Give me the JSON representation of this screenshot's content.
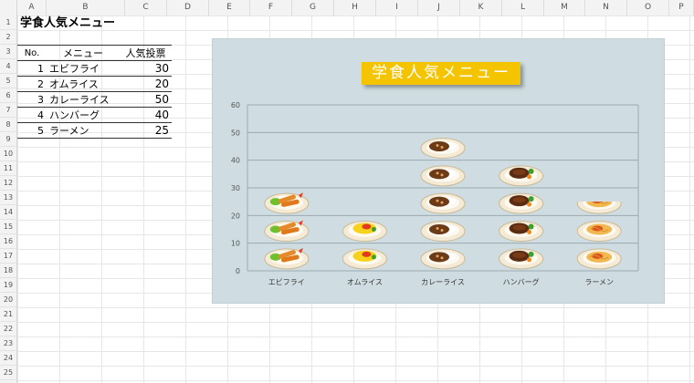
{
  "columns": [
    "A",
    "B",
    "C",
    "D",
    "E",
    "F",
    "G",
    "H",
    "I",
    "J",
    "K",
    "L",
    "M",
    "N",
    "O",
    "P"
  ],
  "rows": [
    "1",
    "2",
    "3",
    "4",
    "5",
    "6",
    "7",
    "8",
    "9",
    "10",
    "11",
    "12",
    "13",
    "14",
    "15",
    "16",
    "17",
    "18",
    "19",
    "20",
    "21",
    "22",
    "23",
    "24",
    "25"
  ],
  "sheet_title": "学食人気メニュー",
  "table": {
    "headers": {
      "no": "No.",
      "menu": "メニュー",
      "votes": "人気投票"
    },
    "rows": [
      {
        "no": "1",
        "menu": "エビフライ",
        "votes": "30"
      },
      {
        "no": "2",
        "menu": "オムライス",
        "votes": "20"
      },
      {
        "no": "3",
        "menu": "カレーライス",
        "votes": "50"
      },
      {
        "no": "4",
        "menu": "ハンバーグ",
        "votes": "40"
      },
      {
        "no": "5",
        "menu": "ラーメン",
        "votes": "25"
      }
    ]
  },
  "chart_data": {
    "type": "bar",
    "title": "学食人気メニュー",
    "categories": [
      "エビフライ",
      "オムライス",
      "カレーライス",
      "ハンバーグ",
      "ラーメン"
    ],
    "values": [
      30,
      20,
      50,
      40,
      25
    ],
    "ylim": [
      0,
      60
    ],
    "yticks": [
      "0",
      "10",
      "20",
      "30",
      "40",
      "50",
      "60"
    ],
    "grid": true,
    "background": "#cfdde2",
    "title_color": "#f5c400",
    "bar_style": "stacked food picture icons (one icon per 10 votes)"
  }
}
